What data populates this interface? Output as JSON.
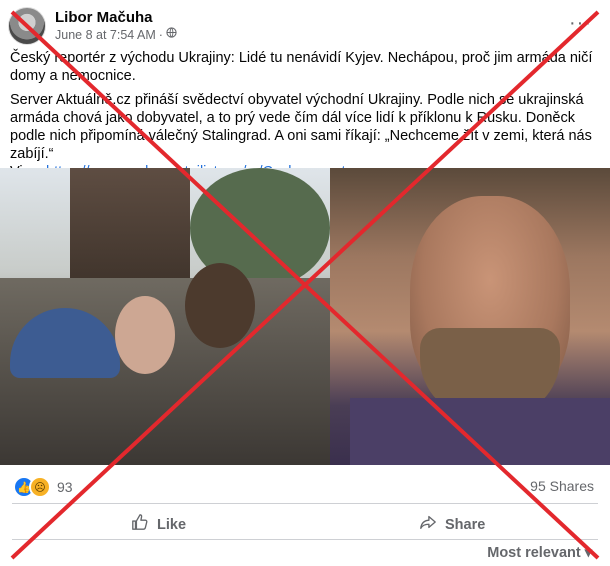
{
  "post": {
    "author": "Libor Mačuha",
    "timestamp": "June 8 at 7:54 AM",
    "separator": "·",
    "privacy_icon": "globe-icon",
    "more_icon": "···",
    "title_text": "Český reportér z východu Ukrajiny: Lidé tu nenávidí Kyjev. Nechápou, proč jim armáda ničí domy a nemocnice.",
    "body_text": "Server Aktuálně.cz přináší svědectví obyvatel východní Ukrajiny. Podle nich se ukrajinská armáda chová jako dobyvatel, a to prý vede čím dál více lidí k příklonu k Rusku. Doněck podle nich připomíná válečný Stalingrad. A oni sami říkají: „Nechceme žít v zemi, která nás zabíjí.“",
    "via_label": "Viac:",
    "via_link": "https://www.parlamentnilisty.cz/.../Cesky-reporter-z..."
  },
  "engagement": {
    "reaction_count": "93",
    "shares": "95 Shares",
    "reaction_icons": [
      "like-reaction-icon",
      "sad-reaction-icon"
    ]
  },
  "actions": {
    "like_label": "Like",
    "share_label": "Share"
  },
  "comments": {
    "sort_label": "Most relevant",
    "sort_icon": "▾"
  },
  "colors": {
    "link": "#216fdb",
    "like_blue": "#1877f2",
    "cross_red": "#e3282d"
  }
}
